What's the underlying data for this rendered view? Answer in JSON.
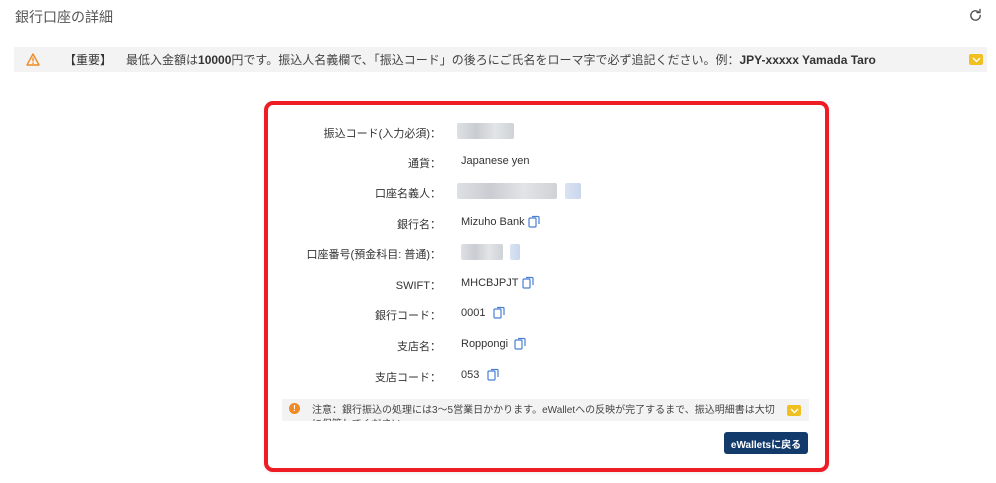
{
  "page": {
    "title": "銀行口座の詳細"
  },
  "notice": {
    "important": "【重要】",
    "text_prefix": "最低入金額は",
    "amount": "10000",
    "text_mid": "円です。振込人名義欄で、「振込コード」の後ろにご氏名をローマ字で必ず追記ください。例：",
    "example": "JPY-xxxxx Yamada Taro"
  },
  "details": {
    "transfer_code_label": "振込コード(入力必須)：",
    "currency_label": "通貨：",
    "currency_value": "Japanese yen",
    "account_holder_label": "口座名義人：",
    "bank_name_label": "銀行名：",
    "bank_name_value": "Mizuho Bank",
    "account_number_label": "口座番号(預金科目: 普通)：",
    "swift_label": "SWIFT：",
    "swift_value": "MHCBJPJT",
    "bank_code_label": "銀行コード：",
    "bank_code_value": "0001",
    "branch_name_label": "支店名：",
    "branch_name_value": "Roppongi",
    "branch_code_label": "支店コード：",
    "branch_code_value": "053"
  },
  "note": {
    "text": "注意：銀行振込の処理には3～5営業日かかります。eWalletへの反映が完了するまで、振込明細書は大切に保管してください。"
  },
  "buttons": {
    "back_label": "eWalletsに戻る"
  },
  "colors": {
    "accent": "#123a6b",
    "highlight_border": "#ee1c25",
    "warning": "#f08a24",
    "expand": "#f0c020"
  }
}
